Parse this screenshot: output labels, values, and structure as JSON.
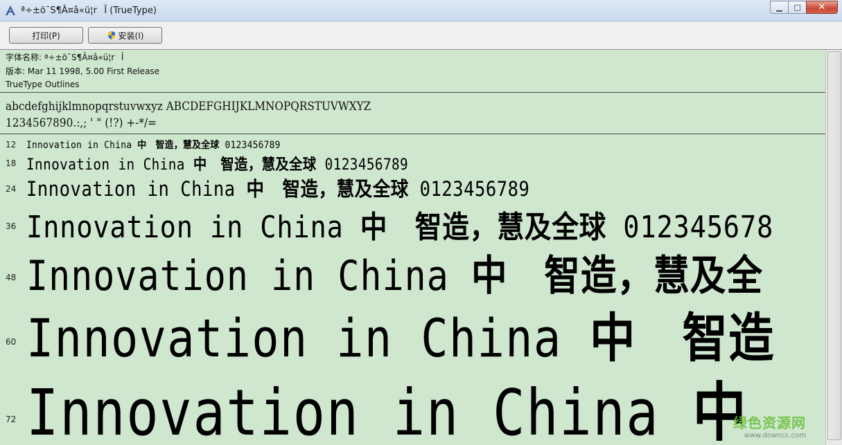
{
  "window": {
    "title": "ª÷±ö¯S¶Â¤â«ü¦rÎ (TrueType)",
    "min_label": "▁",
    "max_label": "□",
    "close_label": "✕"
  },
  "toolbar": {
    "print_label": "打印(P)",
    "install_label": "安装(I)"
  },
  "info": {
    "font_name": "字体名称: ª÷±ö¯S¶Â¤â«ü¦rÎ",
    "version": "版本: Mar 11 1998, 5.00 First Release",
    "outline": "TrueType Outlines"
  },
  "charset": {
    "line1": "abcdefghijklmnopqrstuvwxyz ABCDEFGHIJKLMNOPQRSTUVWXYZ",
    "line2": "1234567890.:,; ' \" (!?) +-*/="
  },
  "samples": [
    {
      "size": "12",
      "latin": "Innovation in China",
      "cjk": "中　智造，慧及全球",
      "digits": "0123456789"
    },
    {
      "size": "18",
      "latin": "Innovation in China",
      "cjk": "中　智造，慧及全球",
      "digits": "0123456789"
    },
    {
      "size": "24",
      "latin": "Innovation in China",
      "cjk": "中　智造，慧及全球",
      "digits": "0123456789"
    },
    {
      "size": "36",
      "latin": "Innovation in China",
      "cjk": "中　智造，慧及全球",
      "digits": "012345678"
    },
    {
      "size": "48",
      "latin": "Innovation in China",
      "cjk": "中　智造，慧及全",
      "digits": ""
    },
    {
      "size": "60",
      "latin": "Innovation in China",
      "cjk": "中　智造",
      "digits": ""
    },
    {
      "size": "72",
      "latin": "Innovation in China",
      "cjk": "中",
      "digits": ""
    }
  ],
  "watermark": {
    "main": "绿色资源网",
    "sub": "www.downcc.com"
  },
  "colors": {
    "background": "#cfe6cf",
    "watermark": "#6bbf3c"
  }
}
